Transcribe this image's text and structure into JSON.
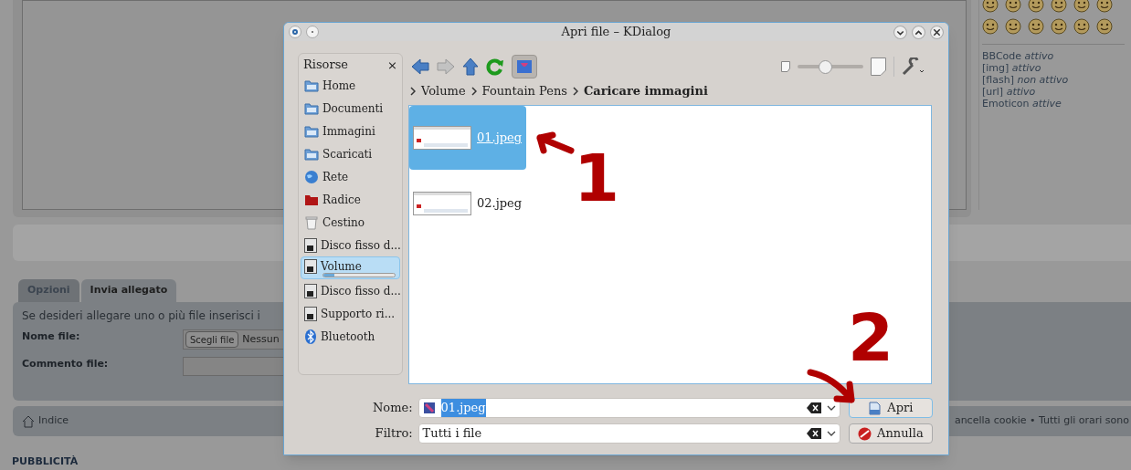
{
  "page": {
    "bbcode_status": [
      "BBCode *attivo*",
      "[img] *attivo*",
      "[flash] *non attivo*",
      "[url] *attivo*",
      "Emoticon *attive*"
    ],
    "tabs": [
      {
        "label": "Opzioni",
        "selected": false
      },
      {
        "label": "Invia allegato",
        "selected": true
      }
    ],
    "attach_intro": "Se desideri allegare uno o più file inserisci i",
    "file_name_label": "Nome file:",
    "choose_file_button": "Scegli file",
    "no_file_text": "Nessun",
    "comment_label": "Commento file:",
    "footer_link": "Indice",
    "footer_right": "ancella cookie • Tutti gli orari sono",
    "ads_heading": "PUBBLICITÀ"
  },
  "dialog": {
    "title": "Apri file – KDialog",
    "places_title": "Risorse",
    "places_close": "×",
    "places": [
      {
        "label": "Home",
        "selected": false
      },
      {
        "label": "Documenti",
        "selected": false
      },
      {
        "label": "Immagini",
        "selected": false
      },
      {
        "label": "Scaricati",
        "selected": false
      },
      {
        "label": "Rete",
        "selected": false
      },
      {
        "label": "Radice",
        "selected": false
      },
      {
        "label": "Cestino",
        "selected": false
      },
      {
        "label": "Disco fisso d...",
        "selected": false
      },
      {
        "label": "Volume",
        "selected": true,
        "level": 0.15
      },
      {
        "label": "Disco fisso d...",
        "selected": false
      },
      {
        "label": "Supporto ri...",
        "selected": false
      },
      {
        "label": "Bluetooth",
        "selected": false
      }
    ],
    "zoom_slider": {
      "level": 0.4
    },
    "breadcrumb": [
      {
        "label": "Volume",
        "current": false
      },
      {
        "label": "Fountain Pens",
        "current": false
      },
      {
        "label": "Caricare immagini",
        "current": true
      }
    ],
    "files": [
      {
        "name": "01.jpeg",
        "selected": true
      },
      {
        "name": "02.jpeg",
        "selected": false
      }
    ],
    "name_label": "Nome:",
    "name_value": "01.jpeg",
    "filter_label": "Filtro:",
    "filter_value": "Tutti i file",
    "open_button": "Apri",
    "cancel_button": "Annulla"
  },
  "annotations": [
    "1",
    "2"
  ]
}
